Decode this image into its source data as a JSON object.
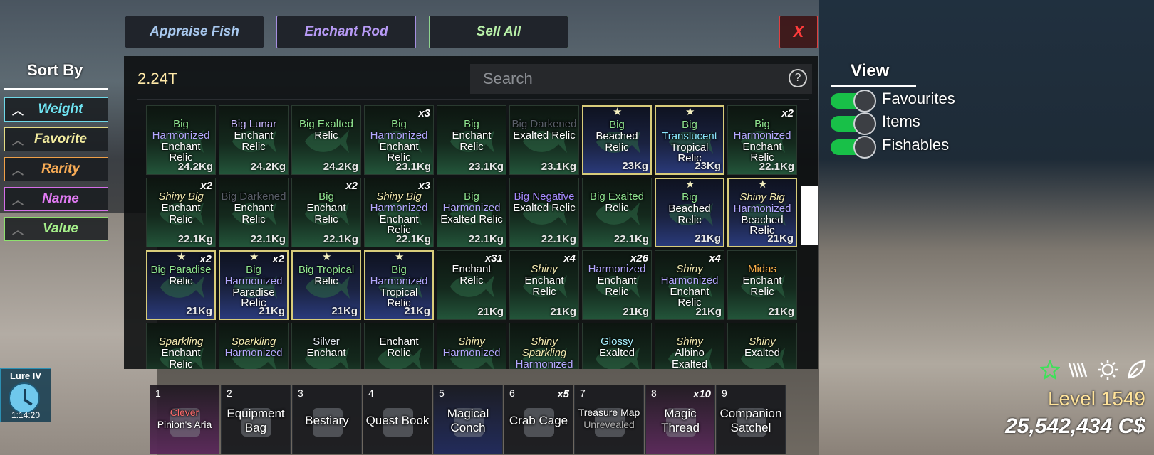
{
  "buttons": {
    "appraise": "Appraise Fish",
    "enchant": "Enchant Rod",
    "sell": "Sell All",
    "close": "X"
  },
  "inventory": {
    "currency": "2.24T",
    "search_placeholder": "Search",
    "help": "?",
    "cells": [
      {
        "lines": [
          [
            "Big",
            "big"
          ],
          [
            "Harmonized",
            "harm"
          ],
          [
            "Enchant Relic",
            ""
          ]
        ],
        "weight": "24.2Kg"
      },
      {
        "lines": [
          [
            "Big Lunar",
            "lunar"
          ],
          [
            "Enchant",
            ""
          ],
          [
            "Relic",
            ""
          ]
        ],
        "weight": "24.2Kg"
      },
      {
        "lines": [
          [
            "Big Exalted",
            "big"
          ],
          [
            "Relic",
            ""
          ]
        ],
        "weight": "24.2Kg"
      },
      {
        "qty": "x3",
        "lines": [
          [
            "Big",
            "big"
          ],
          [
            "Harmonized",
            "harm"
          ],
          [
            "Enchant Relic",
            ""
          ]
        ],
        "weight": "23.1Kg"
      },
      {
        "lines": [
          [
            "Big",
            "big"
          ],
          [
            "Enchant",
            ""
          ],
          [
            "Relic",
            ""
          ]
        ],
        "weight": "23.1Kg"
      },
      {
        "lines": [
          [
            "Big Darkened",
            "dark"
          ],
          [
            "Exalted Relic",
            ""
          ]
        ],
        "weight": "23.1Kg"
      },
      {
        "fav": true,
        "blue": true,
        "lines": [
          [
            "Big",
            "big"
          ],
          [
            "Beached",
            ""
          ],
          [
            "Relic",
            ""
          ]
        ],
        "weight": "23Kg"
      },
      {
        "fav": true,
        "blue": true,
        "lines": [
          [
            "Big",
            "big"
          ],
          [
            "Translucent",
            "trans"
          ],
          [
            "Tropical Relic",
            ""
          ]
        ],
        "weight": "23Kg"
      },
      {
        "qty": "x2",
        "lines": [
          [
            "Big",
            "big"
          ],
          [
            "Harmonized",
            "harm"
          ],
          [
            "Enchant Relic",
            ""
          ]
        ],
        "weight": "22.1Kg"
      },
      {
        "qty": "x2",
        "lines": [
          [
            "Shiny Big",
            "shiny"
          ],
          [
            "Enchant",
            ""
          ],
          [
            "Relic",
            ""
          ]
        ],
        "weight": "22.1Kg"
      },
      {
        "lines": [
          [
            "Big Darkened",
            "dark"
          ],
          [
            "Enchant Relic",
            ""
          ]
        ],
        "weight": "22.1Kg"
      },
      {
        "qty": "x2",
        "lines": [
          [
            "Big",
            "big"
          ],
          [
            "Enchant",
            ""
          ],
          [
            "Relic",
            ""
          ]
        ],
        "weight": "22.1Kg"
      },
      {
        "qty": "x3",
        "lines": [
          [
            "Shiny Big",
            "shiny"
          ],
          [
            "Harmonized",
            "harm"
          ],
          [
            "Enchant Relic",
            ""
          ]
        ],
        "weight": "22.1Kg"
      },
      {
        "lines": [
          [
            "Big",
            "big"
          ],
          [
            "Harmonized",
            "harm"
          ],
          [
            "Exalted Relic",
            ""
          ]
        ],
        "weight": "22.1Kg"
      },
      {
        "lines": [
          [
            "Big Negative",
            "neg"
          ],
          [
            "Exalted Relic",
            ""
          ]
        ],
        "weight": "22.1Kg"
      },
      {
        "lines": [
          [
            "Big Exalted",
            "big"
          ],
          [
            "Relic",
            ""
          ]
        ],
        "weight": "22.1Kg"
      },
      {
        "fav": true,
        "blue": true,
        "lines": [
          [
            "Big",
            "big"
          ],
          [
            "Beached",
            ""
          ],
          [
            "Relic",
            ""
          ]
        ],
        "weight": "21Kg"
      },
      {
        "fav": true,
        "blue": true,
        "lines": [
          [
            "Shiny Big",
            "shiny"
          ],
          [
            "Harmonized",
            "harm"
          ],
          [
            "Beached",
            ""
          ],
          [
            "Relic",
            ""
          ]
        ],
        "weight": "21Kg"
      },
      {
        "fav": true,
        "blue": true,
        "qty": "x2",
        "lines": [
          [
            "Big Paradise",
            "big"
          ],
          [
            "Relic",
            ""
          ]
        ],
        "weight": "21Kg"
      },
      {
        "fav": true,
        "blue": true,
        "qty": "x2",
        "lines": [
          [
            "Big",
            "big"
          ],
          [
            "Harmonized",
            "harm"
          ],
          [
            "Paradise",
            ""
          ],
          [
            "Relic",
            ""
          ]
        ],
        "weight": "21Kg"
      },
      {
        "fav": true,
        "blue": true,
        "lines": [
          [
            "Big Tropical",
            "big"
          ],
          [
            "Relic",
            ""
          ]
        ],
        "weight": "21Kg"
      },
      {
        "fav": true,
        "blue": true,
        "lines": [
          [
            "Big",
            "big"
          ],
          [
            "Harmonized",
            "harm"
          ],
          [
            "Tropical Relic",
            ""
          ]
        ],
        "weight": "21Kg"
      },
      {
        "qty": "x31",
        "lines": [
          [
            "Enchant",
            ""
          ],
          [
            "Relic",
            ""
          ]
        ],
        "weight": "21Kg"
      },
      {
        "qty": "x4",
        "lines": [
          [
            "Shiny",
            "shiny"
          ],
          [
            "Enchant",
            ""
          ],
          [
            "Relic",
            ""
          ]
        ],
        "weight": "21Kg"
      },
      {
        "qty": "x26",
        "lines": [
          [
            "Harmonized",
            "harm"
          ],
          [
            "Enchant Relic",
            ""
          ]
        ],
        "weight": "21Kg"
      },
      {
        "qty": "x4",
        "lines": [
          [
            "Shiny",
            "shiny"
          ],
          [
            "Harmonized",
            "harm"
          ],
          [
            "Enchant Relic",
            ""
          ]
        ],
        "weight": "21Kg"
      },
      {
        "lines": [
          [
            "Midas",
            "midas"
          ],
          [
            "Enchant",
            ""
          ],
          [
            "Relic",
            ""
          ]
        ],
        "weight": "21Kg"
      },
      {
        "lines": [
          [
            "Sparkling",
            "sparkling"
          ],
          [
            "Enchant Relic",
            ""
          ]
        ],
        "weight": ""
      },
      {
        "lines": [
          [
            "Sparkling",
            "sparkling"
          ],
          [
            "Harmonized",
            "harm"
          ]
        ],
        "weight": ""
      },
      {
        "lines": [
          [
            "Silver",
            "silver"
          ],
          [
            "Enchant",
            ""
          ]
        ],
        "weight": ""
      },
      {
        "lines": [
          [
            "Enchant",
            ""
          ],
          [
            "Relic",
            ""
          ]
        ],
        "weight": ""
      },
      {
        "lines": [
          [
            "Shiny",
            "shiny"
          ],
          [
            "Harmonized",
            "harm"
          ]
        ],
        "weight": ""
      },
      {
        "lines": [
          [
            "Shiny",
            "shiny"
          ],
          [
            "Sparkling",
            "sparkling"
          ],
          [
            "Harmonized",
            "harm"
          ]
        ],
        "weight": ""
      },
      {
        "lines": [
          [
            "Glossy",
            "glossy"
          ],
          [
            "Exalted",
            ""
          ]
        ],
        "weight": ""
      },
      {
        "lines": [
          [
            "Shiny",
            "shiny"
          ],
          [
            "Albino",
            "albino"
          ],
          [
            "Exalted",
            ""
          ]
        ],
        "weight": ""
      },
      {
        "lines": [
          [
            "Shiny",
            "shiny"
          ],
          [
            "Exalted",
            ""
          ]
        ],
        "weight": ""
      }
    ]
  },
  "sort": {
    "title": "Sort By",
    "options": [
      "Weight",
      "Favorite",
      "Rarity",
      "Name",
      "Value"
    ]
  },
  "view": {
    "title": "View",
    "toggles": [
      {
        "label": "Favourites",
        "on": true
      },
      {
        "label": "Items",
        "on": true
      },
      {
        "label": "Fishables",
        "on": true
      }
    ]
  },
  "lure": {
    "name": "Lure IV",
    "time": "1:14:20"
  },
  "hotbar": [
    {
      "num": "1",
      "lines": [
        [
          "Clever",
          "red"
        ],
        [
          "Pinion's Aria",
          ""
        ]
      ],
      "qty": ""
    },
    {
      "num": "2",
      "lines": [
        [
          "Equipment",
          ""
        ],
        [
          "Bag",
          ""
        ]
      ],
      "qty": ""
    },
    {
      "num": "3",
      "lines": [
        [
          "Bestiary",
          ""
        ]
      ],
      "qty": ""
    },
    {
      "num": "4",
      "lines": [
        [
          "Quest Book",
          ""
        ]
      ],
      "qty": ""
    },
    {
      "num": "5",
      "lines": [
        [
          "Magical",
          ""
        ],
        [
          "Conch",
          ""
        ]
      ],
      "qty": ""
    },
    {
      "num": "6",
      "lines": [
        [
          "Crab Cage",
          ""
        ]
      ],
      "qty": "x5"
    },
    {
      "num": "7",
      "lines": [
        [
          "Treasure Map",
          ""
        ],
        [
          "Unrevealed",
          "grey"
        ]
      ],
      "qty": ""
    },
    {
      "num": "8",
      "lines": [
        [
          "Magic",
          ""
        ],
        [
          "Thread",
          ""
        ]
      ],
      "qty": "x10"
    },
    {
      "num": "9",
      "lines": [
        [
          "Companion",
          ""
        ],
        [
          "Satchel",
          ""
        ]
      ],
      "qty": ""
    }
  ],
  "player": {
    "level": "Level 1549",
    "money": "25,542,434 C$"
  },
  "status_icons": [
    "star-icon",
    "bars-icon",
    "sun-icon",
    "leaf-icon"
  ]
}
